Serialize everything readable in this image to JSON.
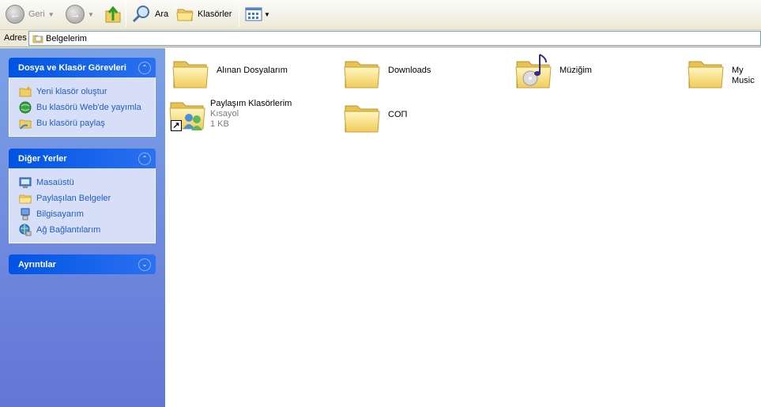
{
  "toolbar": {
    "back_label": "Geri",
    "search_label": "Ara",
    "folders_label": "Klasörler"
  },
  "address": {
    "label": "Adres",
    "value": "Belgelerim"
  },
  "panels": {
    "tasks": {
      "title": "Dosya ve Klasör Görevleri",
      "items": [
        {
          "label": "Yeni klasör oluştur",
          "icon": "new-folder-icon"
        },
        {
          "label": "Bu klasörü Web'de yayımla",
          "icon": "globe-icon"
        },
        {
          "label": "Bu klasörü paylaş",
          "icon": "share-folder-icon"
        }
      ]
    },
    "places": {
      "title": "Diğer Yerler",
      "items": [
        {
          "label": "Masaüstü",
          "icon": "desktop-icon"
        },
        {
          "label": "Paylaşılan Belgeler",
          "icon": "folder-icon"
        },
        {
          "label": "Bilgisayarım",
          "icon": "computer-icon"
        },
        {
          "label": "Ağ Bağlantılarım",
          "icon": "network-icon"
        }
      ]
    },
    "details": {
      "title": "Ayrıntılar"
    }
  },
  "files": [
    {
      "name": "Alınan Dosyalarım",
      "icon": "folder-icon"
    },
    {
      "name": "Downloads",
      "icon": "folder-icon"
    },
    {
      "name": "Müziğim",
      "icon": "music-folder-icon"
    },
    {
      "name": "My Music",
      "icon": "folder-icon"
    },
    {
      "name": "Paylaşım Klasörlerim",
      "sub1": "Kısayol",
      "sub2": "1 KB",
      "icon": "shared-folder-shortcut-icon"
    },
    {
      "name": "COП",
      "icon": "folder-icon"
    }
  ]
}
